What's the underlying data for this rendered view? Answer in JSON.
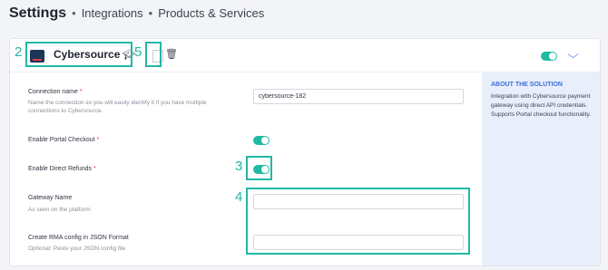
{
  "breadcrumb": {
    "title": "Settings",
    "separator": "•",
    "items": [
      "Integrations",
      "Products & Services"
    ]
  },
  "integration": {
    "name": "Cybersource",
    "enabled": true
  },
  "form": {
    "connection_name": {
      "label": "Connection name",
      "required": "*",
      "hint": "Name the connection so you will easily identify it if you have multiple connections to Cybersource.",
      "value": "cybersource-182"
    },
    "portal_checkout": {
      "label": "Enable Portal Checkout",
      "required": "*",
      "enabled": true
    },
    "direct_refunds": {
      "label": "Enable Direct Refunds",
      "required": "*",
      "enabled": true
    },
    "gateway_name": {
      "label": "Gateway Name",
      "hint": "As seen on the platform",
      "value": ""
    },
    "rma_config": {
      "label": "Create RMA config in JSON Format",
      "hint": "Optional: Paste your JSON config file",
      "value": ""
    }
  },
  "sidebar": {
    "title": "ABOUT THE SOLUTION",
    "description": "Integration with Cybersource payment gateway using direct API credentials. Supports Portal checkout functionality."
  },
  "annotations": [
    "2",
    "5",
    "3",
    "4"
  ],
  "colors": {
    "accent": "#21b8a4",
    "link": "#3b6fd6",
    "required": "#e63946",
    "panel": "#e9eefb"
  },
  "icons": [
    "cybersource-logo-icon",
    "graduation-cap-icon",
    "file-icon",
    "trash-icon",
    "chevron-down-icon"
  ]
}
